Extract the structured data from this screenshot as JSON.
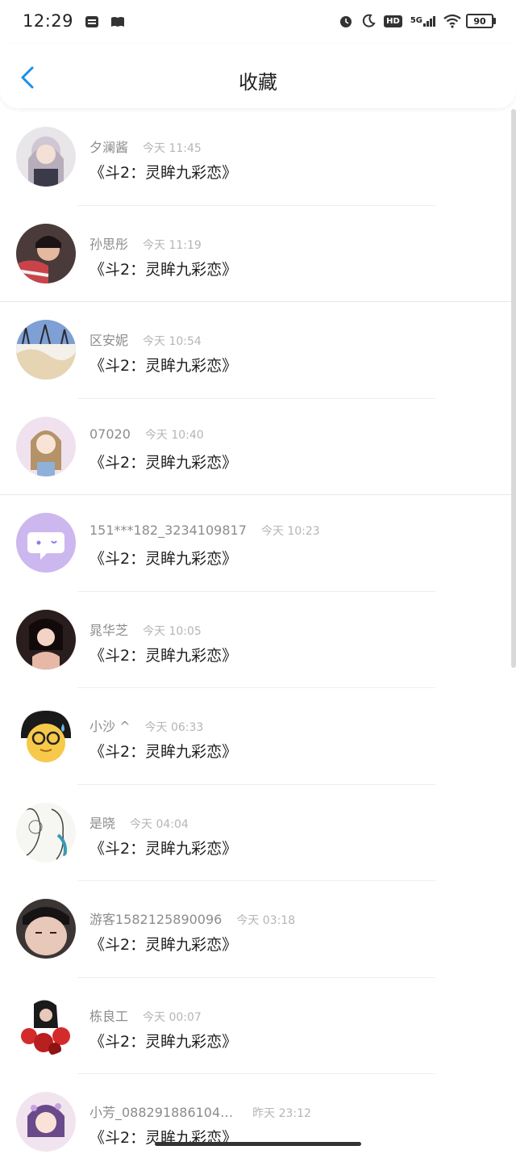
{
  "status_bar": {
    "time": "12:29",
    "battery": "90",
    "network": "5G",
    "hd": "HD"
  },
  "header": {
    "title": "收藏"
  },
  "items": [
    {
      "name": "夕澜酱",
      "time": "今天 11:45",
      "content": "《斗2：灵眸九彩恋》"
    },
    {
      "name": "孙思彤",
      "time": "今天 11:19",
      "content": "《斗2：灵眸九彩恋》"
    },
    {
      "name": "区安妮",
      "time": "今天 10:54",
      "content": "《斗2：灵眸九彩恋》"
    },
    {
      "name": "07020",
      "time": "今天 10:40",
      "content": "《斗2：灵眸九彩恋》"
    },
    {
      "name": "151***182_3234109817",
      "time": "今天 10:23",
      "content": "《斗2：灵眸九彩恋》"
    },
    {
      "name": "晁华芝",
      "time": "今天 10:05",
      "content": "《斗2：灵眸九彩恋》"
    },
    {
      "name": "小沙 ^",
      "time": "今天 06:33",
      "content": "《斗2：灵眸九彩恋》"
    },
    {
      "name": "是晓",
      "time": "今天 04:04",
      "content": "《斗2：灵眸九彩恋》"
    },
    {
      "name": "游客1582125890096",
      "time": "今天 03:18",
      "content": "《斗2：灵眸九彩恋》"
    },
    {
      "name": "栋良工",
      "time": "今天 00:07",
      "content": "《斗2：灵眸九彩恋》"
    },
    {
      "name": "小芳_088291886104…",
      "time": "昨天 23:12",
      "content": "《斗2：灵眸九彩恋》"
    }
  ],
  "colors": {
    "accent": "#1a8fe8",
    "name": "#8c8c8c",
    "time": "#b5b5b5",
    "content": "#1e1e1e"
  }
}
